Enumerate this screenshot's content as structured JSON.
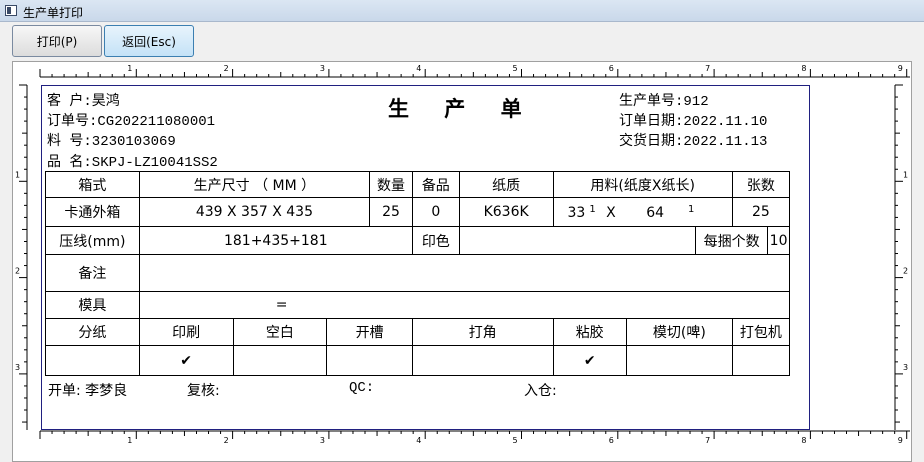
{
  "window": {
    "title": "生产单打印"
  },
  "toolbar": {
    "print_label": "打印(P)",
    "back_label": "返回(Esc)"
  },
  "ruler": {
    "top_numbers": [
      "1",
      "2",
      "3",
      "4",
      "5",
      "6",
      "7",
      "8",
      "9"
    ],
    "side_numbers": [
      "1",
      "2",
      "3"
    ]
  },
  "doc": {
    "title": "生 产 单",
    "customer": "客  户:昊鸿",
    "order_no": "订单号:CG202211080001",
    "material_no": "料  号:3230103069",
    "product_name": "品  名:SKPJ-LZ10041SS2",
    "prod_no": "生产单号:912",
    "order_date": "订单日期:2022.11.10",
    "delivery_date": "交货日期:2022.11.13",
    "table": {
      "h_box": "箱式",
      "h_size": "生产尺寸 （   MM   ）",
      "h_qty": "数量",
      "h_spare": "备品",
      "h_paper": "纸质",
      "h_usage": "用料(纸度X纸长)",
      "h_sheets": "张数",
      "box": "卡通外箱",
      "size": "439 X 357 X 435",
      "qty": "25",
      "spare": "0",
      "paper": "K636K",
      "usage_w": "33",
      "usage_w_sup": "1",
      "usage_x": "X",
      "usage_l": "64",
      "usage_l_sup": "1",
      "sheets": "25",
      "crease_label": "压线(mm)",
      "crease": "181+435+181",
      "color_label": "印色",
      "color": "",
      "per_bundle_label": "每捆个数",
      "per_bundle": "10",
      "remark_label": "备注",
      "remark": "",
      "mold_label": "模具",
      "mold": "=",
      "p_split": "分纸",
      "p_print": "印刷",
      "p_blank": "空白",
      "p_slot": "开槽",
      "p_corner": "打角",
      "p_glue": "粘胶",
      "p_die": "模切(啤)",
      "p_bale": "打包机",
      "check_print": "✔",
      "check_glue": "✔"
    },
    "footer": {
      "issuer": "开单: 李梦良",
      "review": "复核:",
      "qc": "QC:",
      "stock": "入仓:"
    }
  }
}
